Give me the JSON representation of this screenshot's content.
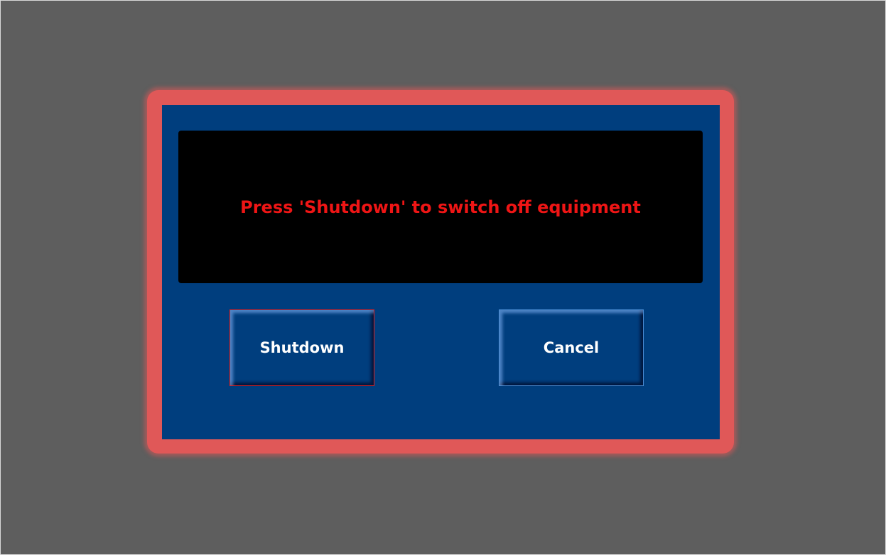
{
  "dialog": {
    "message": "Press 'Shutdown' to switch off equipment",
    "shutdown_label": "Shutdown",
    "cancel_label": "Cancel"
  },
  "colors": {
    "background": "#5e5e5e",
    "dialog_border": "#e05858",
    "dialog_fill": "#003e7e",
    "message_background": "#000000",
    "message_text": "#ee1515",
    "shutdown_button_border": "#e02020",
    "cancel_button_border": "#4d8fd6"
  }
}
